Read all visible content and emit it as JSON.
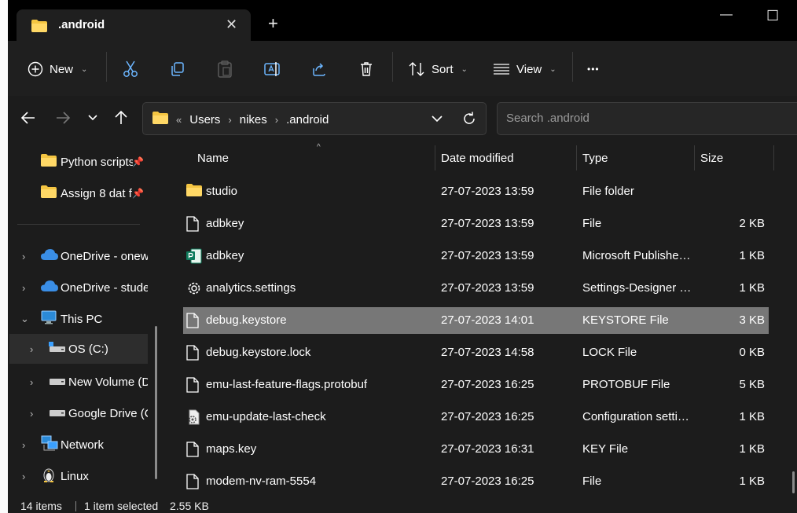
{
  "window": {
    "tab_title": ".android",
    "new_tab": "+",
    "minimize": "—",
    "maximize": "☐"
  },
  "toolbar": {
    "new_label": "New",
    "sort_label": "Sort",
    "view_label": "View",
    "more_label": "•••"
  },
  "address": {
    "overflow": "«",
    "crumbs": [
      "Users",
      "nikes",
      ".android"
    ]
  },
  "search": {
    "placeholder": "Search .android"
  },
  "sidebar": {
    "items": [
      {
        "label": "Python scripts",
        "icon": "folder-icon",
        "pinned": true
      },
      {
        "label": "Assign 8 dat f",
        "icon": "folder-icon",
        "pinned": true
      },
      {
        "label": "OneDrive - onew",
        "icon": "cloud-icon"
      },
      {
        "label": "OneDrive - stude",
        "icon": "cloud-icon"
      },
      {
        "label": "This PC",
        "icon": "pc-icon"
      },
      {
        "label": "OS (C:)",
        "icon": "drive-icon"
      },
      {
        "label": "New Volume (D",
        "icon": "drive-icon"
      },
      {
        "label": "Google Drive (C",
        "icon": "drive-icon"
      },
      {
        "label": "Network",
        "icon": "network-icon"
      },
      {
        "label": "Linux",
        "icon": "penguin-icon"
      }
    ]
  },
  "columns": {
    "name": "Name",
    "date": "Date modified",
    "type": "Type",
    "size": "Size"
  },
  "files": [
    {
      "name": "studio",
      "date": "27-07-2023 13:59",
      "type": "File folder",
      "size": "",
      "icon": "folder-icon"
    },
    {
      "name": "adbkey",
      "date": "27-07-2023 13:59",
      "type": "File",
      "size": "2 KB",
      "icon": "file-icon"
    },
    {
      "name": "adbkey",
      "date": "27-07-2023 13:59",
      "type": "Microsoft Publishe…",
      "size": "1 KB",
      "icon": "publisher-icon"
    },
    {
      "name": "analytics.settings",
      "date": "27-07-2023 13:59",
      "type": "Settings-Designer …",
      "size": "1 KB",
      "icon": "settings-icon"
    },
    {
      "name": "debug.keystore",
      "date": "27-07-2023 14:01",
      "type": "KEYSTORE File",
      "size": "3 KB",
      "icon": "file-icon",
      "selected": true
    },
    {
      "name": "debug.keystore.lock",
      "date": "27-07-2023 14:58",
      "type": "LOCK File",
      "size": "0 KB",
      "icon": "file-icon"
    },
    {
      "name": "emu-last-feature-flags.protobuf",
      "date": "27-07-2023 16:25",
      "type": "PROTOBUF File",
      "size": "5 KB",
      "icon": "file-icon"
    },
    {
      "name": "emu-update-last-check",
      "date": "27-07-2023 16:25",
      "type": "Configuration setti…",
      "size": "1 KB",
      "icon": "config-icon"
    },
    {
      "name": "maps.key",
      "date": "27-07-2023 16:31",
      "type": "KEY File",
      "size": "1 KB",
      "icon": "file-icon"
    },
    {
      "name": "modem-nv-ram-5554",
      "date": "27-07-2023 16:25",
      "type": "File",
      "size": "1 KB",
      "icon": "file-icon"
    }
  ],
  "status": {
    "items_count": "14 items",
    "selected": "1 item selected",
    "selected_size": "2.55 KB"
  },
  "colors": {
    "window_bg": "#1c1c1c",
    "titlebar_bg": "#000000",
    "selection": "#777777",
    "folder_yellow": "#f4c542",
    "onedrive_blue": "#3a8ee6"
  }
}
